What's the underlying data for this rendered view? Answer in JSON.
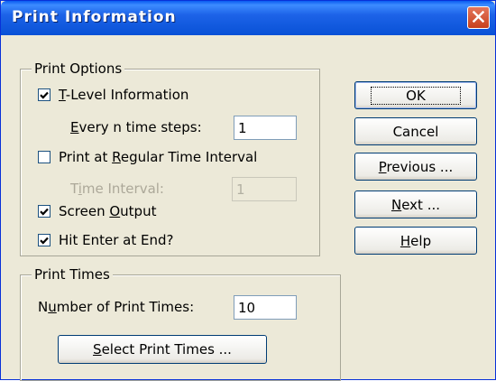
{
  "window": {
    "title": "Print Information"
  },
  "print_options": {
    "legend": "Print Options",
    "tlevel": {
      "label_key": "T",
      "label_rest": "-Level Information",
      "checked": true
    },
    "every_n": {
      "label_key": "E",
      "label_rest": "very n time steps:",
      "value": "1"
    },
    "regular_interval": {
      "label_pre": "Print at ",
      "label_key": "R",
      "label_rest": "egular Time Interval",
      "checked": false
    },
    "time_interval": {
      "label_pre": "T",
      "label_key": "i",
      "label_rest": "me Interval:",
      "value": "1"
    },
    "screen_output": {
      "label_pre": "Screen ",
      "label_key": "O",
      "label_rest": "utput",
      "checked": true
    },
    "hit_enter": {
      "label": "Hit Enter at End?",
      "checked": true
    }
  },
  "print_times": {
    "legend": "Print Times",
    "number": {
      "label_pre": "N",
      "label_key": "u",
      "label_rest": "mber of Print Times:",
      "value": "10"
    },
    "select_button": {
      "label_key": "S",
      "label_rest": "elect Print Times ..."
    }
  },
  "buttons": {
    "ok": "OK",
    "cancel": "Cancel",
    "previous": {
      "label_key": "P",
      "label_rest": "revious ..."
    },
    "next": {
      "label_key": "N",
      "label_rest": "ext ..."
    },
    "help": {
      "label_key": "H",
      "label_rest": "elp"
    }
  }
}
